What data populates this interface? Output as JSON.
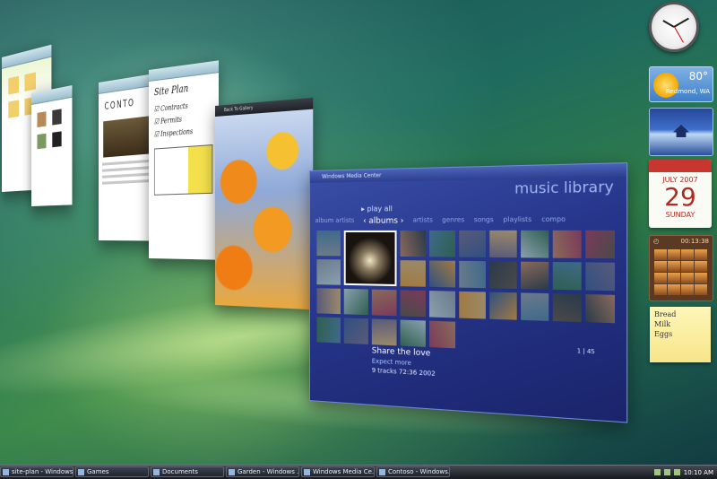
{
  "desktop": {
    "window_site_plan": {
      "title": "Site Plan",
      "checklist": [
        "Contracts",
        "Permits",
        "Inspections"
      ]
    },
    "window_contoso": {
      "brand": "CONTO"
    },
    "window_garden": {
      "back_label": "Back To Gallery"
    },
    "media_center": {
      "window_title": "Windows Media Center",
      "heading": "music library",
      "play_all": "play all",
      "tabs": [
        "album artists",
        "albums",
        "artists",
        "genres",
        "songs",
        "playlists",
        "compo"
      ],
      "selected_tab": "albums",
      "album_title": "Share the love",
      "album_subtitle": "Expect more",
      "album_meta": "9 tracks  72:36  2002",
      "page_indicator": "1 | 45"
    }
  },
  "gadgets": {
    "weather": {
      "temperature": "80°",
      "city": "Redmond, WA"
    },
    "calendar": {
      "month": "JULY 2007",
      "day": "29",
      "weekday": "SUNDAY"
    },
    "puzzle_timer": "00:13:38",
    "notes": [
      "Bread",
      "Milk",
      "Eggs"
    ]
  },
  "taskbar": {
    "buttons": [
      "site-plan - Windows...",
      "Games",
      "Documents",
      "Garden - Windows ...",
      "Windows Media Ce...",
      "Contoso - Windows..."
    ],
    "clock": "10:10 AM"
  },
  "colors": {
    "wallpaper": "#1f6a5e",
    "media_center": "#26358a",
    "calendar_red": "#c8372f",
    "taskbar": "#16191e"
  }
}
